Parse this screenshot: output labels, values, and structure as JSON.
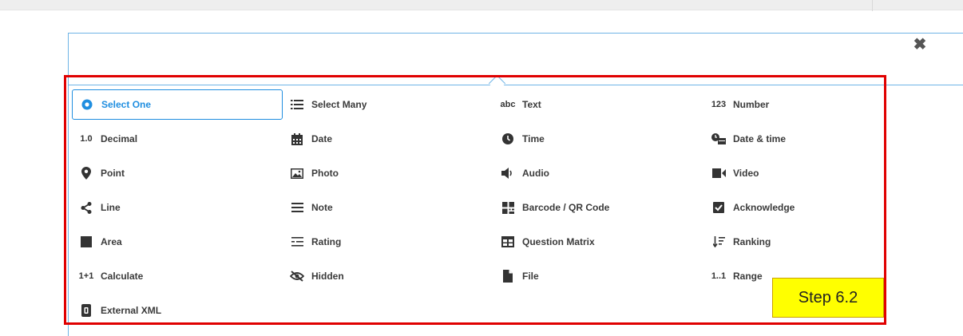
{
  "dialog": {
    "close_label": "✖",
    "accent_color": "#1f8ee0",
    "highlight_color": "#e00000"
  },
  "annotation": {
    "step_label": "Step 6.2"
  },
  "question_types": [
    {
      "label": "Select One",
      "icon": "radio-dot-icon",
      "selected": true
    },
    {
      "label": "Select Many",
      "icon": "list-icon"
    },
    {
      "label": "Text",
      "icon": "abc-icon",
      "icon_text": "abc"
    },
    {
      "label": "Number",
      "icon": "number-icon",
      "icon_text": "123"
    },
    {
      "label": "Decimal",
      "icon": "decimal-icon",
      "icon_text": "1.0"
    },
    {
      "label": "Date",
      "icon": "calendar-icon"
    },
    {
      "label": "Time",
      "icon": "clock-icon"
    },
    {
      "label": "Date & time",
      "icon": "date-time-icon"
    },
    {
      "label": "Point",
      "icon": "map-pin-icon"
    },
    {
      "label": "Photo",
      "icon": "photo-icon"
    },
    {
      "label": "Audio",
      "icon": "speaker-icon"
    },
    {
      "label": "Video",
      "icon": "video-icon"
    },
    {
      "label": "Line",
      "icon": "share-line-icon"
    },
    {
      "label": "Note",
      "icon": "hamburger-icon"
    },
    {
      "label": "Barcode / QR Code",
      "icon": "qr-code-icon"
    },
    {
      "label": "Acknowledge",
      "icon": "checkbox-icon"
    },
    {
      "label": "Area",
      "icon": "square-icon"
    },
    {
      "label": "Rating",
      "icon": "rating-icon"
    },
    {
      "label": "Question Matrix",
      "icon": "table-icon"
    },
    {
      "label": "Ranking",
      "icon": "sort-icon"
    },
    {
      "label": "Calculate",
      "icon": "calculate-icon",
      "icon_text": "1+1"
    },
    {
      "label": "Hidden",
      "icon": "eye-slash-icon"
    },
    {
      "label": "File",
      "icon": "file-icon"
    },
    {
      "label": "Range",
      "icon": "range-icon",
      "icon_text": "1..1"
    },
    {
      "label": "External XML",
      "icon": "xml-file-icon"
    }
  ]
}
